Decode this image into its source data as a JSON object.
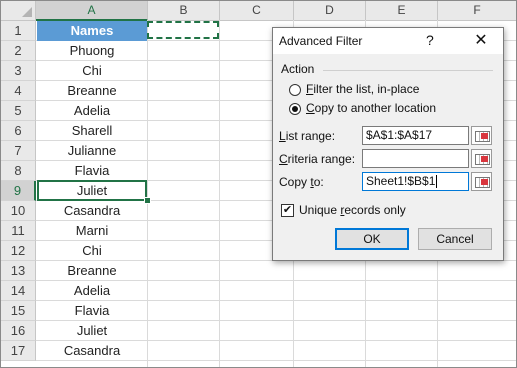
{
  "spreadsheet": {
    "columns": [
      "A",
      "B",
      "C",
      "D",
      "E",
      "F"
    ],
    "rows": [
      "1",
      "2",
      "3",
      "4",
      "5",
      "6",
      "7",
      "8",
      "9",
      "10",
      "11",
      "12",
      "13",
      "14",
      "15",
      "16",
      "17"
    ],
    "cells_a": [
      "Names",
      "Phuong",
      "Chi",
      "Breanne",
      "Adelia",
      "Sharell",
      "Julianne",
      "Flavia",
      "Juliet",
      "Casandra",
      "Marni",
      "Chi",
      "Breanne",
      "Adelia",
      "Flavia",
      "Juliet",
      "Casandra"
    ],
    "header_fill_color": "#5b9bd5",
    "selection_color": "#217346"
  },
  "dialog": {
    "title": "Advanced Filter",
    "help_glyph": "?",
    "close_glyph": "✕",
    "action_label": "Action",
    "radio_filter_in_place": {
      "hotkey": "F",
      "rest": "ilter the list, in-place",
      "selected": false
    },
    "radio_copy_to": {
      "hotkey": "C",
      "rest": "opy to another location",
      "selected": true
    },
    "list_range": {
      "hotkey": "L",
      "rest": "ist range:",
      "value": "$A$1:$A$17"
    },
    "criteria_range": {
      "hotkey": "C",
      "rest": "riteria range:",
      "value": ""
    },
    "copy_to": {
      "pre": "Copy ",
      "hotkey": "t",
      "rest": "o:",
      "value": "Sheet1!$B$1"
    },
    "unique_records": {
      "pre": "Unique ",
      "hotkey": "r",
      "rest": "ecords only",
      "checked": true,
      "check_glyph": "✔"
    },
    "ok_label": "OK",
    "cancel_label": "Cancel"
  }
}
